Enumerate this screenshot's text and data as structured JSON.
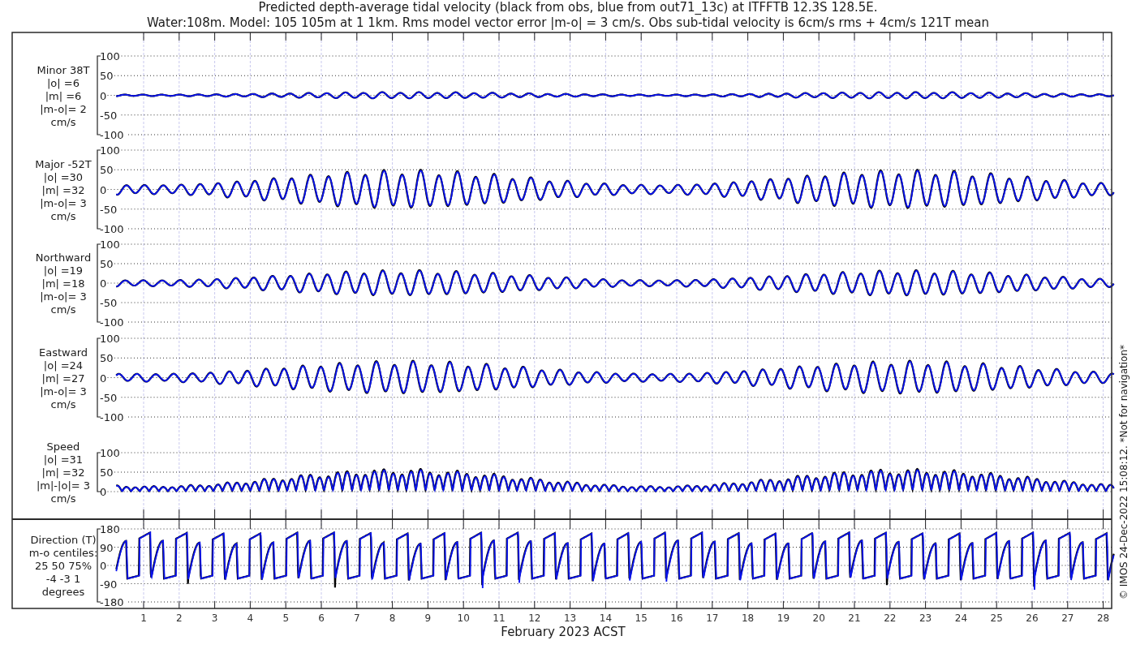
{
  "title_lines": [
    "Predicted depth-average tidal velocity (black from obs, blue from out71_13c) at ITFFTB 12.3S 128.5E.",
    "Water:108m. Model: 105 105m at 1 1km. Rms model vector error |m-o| = 3 cm/s. Obs sub-tidal velocity is 6cm/s rms + 4cm/s 121T mean"
  ],
  "panels": [
    {
      "kind": "velocity",
      "label_lines": [
        "Minor 38T",
        "|o| =6",
        "|m| =6",
        "|m-o|= 2",
        "cm/s"
      ],
      "yticks": [
        "100",
        "50",
        "0",
        "-50",
        "-100"
      ]
    },
    {
      "kind": "velocity",
      "label_lines": [
        "Major -52T",
        "|o| =30",
        "|m| =32",
        "|m-o|= 3",
        "cm/s"
      ],
      "yticks": [
        "100",
        "50",
        "0",
        "-50",
        "-100"
      ]
    },
    {
      "kind": "velocity",
      "label_lines": [
        "Northward",
        "|o| =19",
        "|m| =18",
        "|m-o|= 3",
        "cm/s"
      ],
      "yticks": [
        "100",
        "50",
        "0",
        "-50",
        "-100"
      ]
    },
    {
      "kind": "velocity",
      "label_lines": [
        "Eastward",
        "|o| =24",
        "|m| =27",
        "|m-o|= 3",
        "cm/s"
      ],
      "yticks": [
        "100",
        "50",
        "0",
        "-50",
        "-100"
      ]
    },
    {
      "kind": "speed",
      "label_lines": [
        "Speed",
        "|o| =31",
        "|m| =32",
        "|m|-|o|= 3",
        "cm/s"
      ],
      "yticks": [
        "100",
        "50",
        "0"
      ]
    },
    {
      "kind": "direction",
      "label_lines": [
        "Direction (T)",
        "m-o centiles:",
        "25  50  75%",
        "-4 -3  1",
        "degrees"
      ],
      "yticks": [
        "180",
        "90",
        "0",
        "-90",
        "-180"
      ]
    }
  ],
  "xtick_labels": [
    "1",
    "2",
    "3",
    "4",
    "5",
    "6",
    "7",
    "8",
    "9",
    "10",
    "11",
    "12",
    "13",
    "14",
    "15",
    "16",
    "17",
    "18",
    "19",
    "20",
    "21",
    "22",
    "23",
    "24",
    "25",
    "26",
    "27",
    "28"
  ],
  "xlabel": "February 2023 ACST",
  "credit": "© IMOS 24-Dec-2022 15:08:12.  *Not for navigation*"
}
